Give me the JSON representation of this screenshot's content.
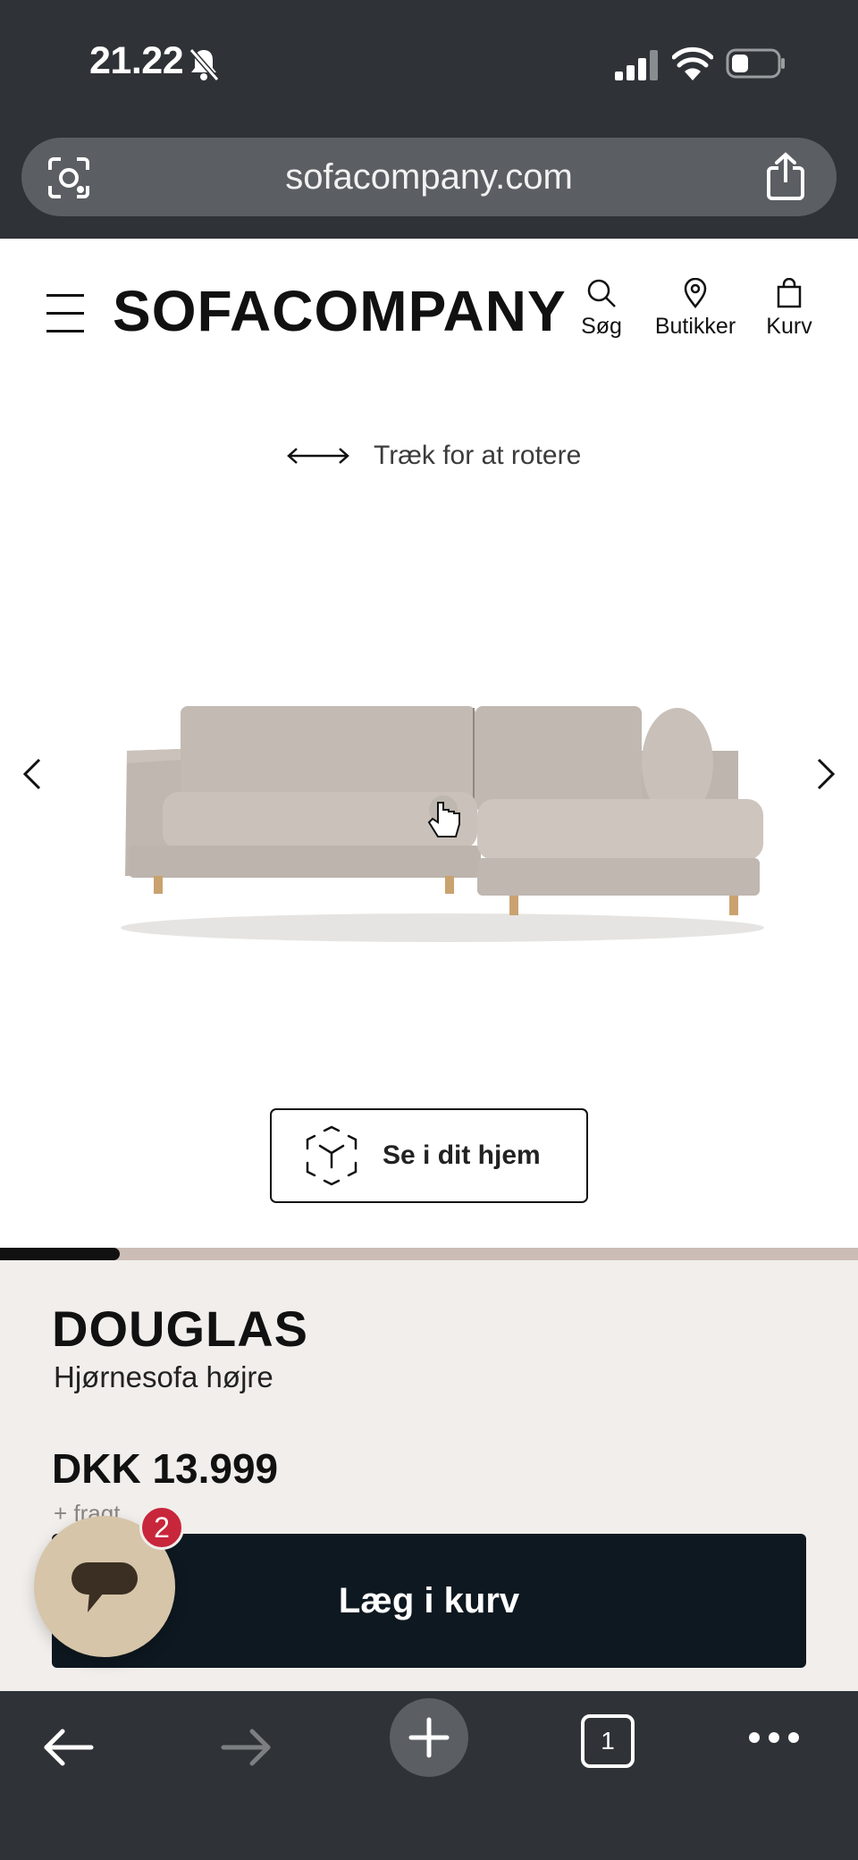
{
  "status_bar": {
    "time": "21.22",
    "icons": [
      "bell-slash-icon",
      "cellular-signal-icon",
      "wifi-icon",
      "battery-icon"
    ]
  },
  "browser": {
    "url": "sofacompany.com",
    "icons": [
      "visual-search-icon",
      "share-icon"
    ],
    "bottom_bar": {
      "tab_count": "1",
      "icons": [
        "back-arrow-icon",
        "forward-arrow-icon",
        "new-tab-plus-icon",
        "tabs-icon",
        "more-icon"
      ]
    }
  },
  "header": {
    "logo": "SOFACOMPANY",
    "nav": [
      {
        "label": "Søg",
        "icon": "search-icon"
      },
      {
        "label": "Butikker",
        "icon": "location-pin-icon"
      },
      {
        "label": "Kurv",
        "icon": "shopping-bag-icon"
      }
    ]
  },
  "viewer": {
    "rotate_hint": "Træk for at rotere",
    "ar_button_label": "Se i dit hjem",
    "image_progress": 0.14
  },
  "product": {
    "name": "DOUGLAS",
    "subtitle": "Hjørnesofa højre",
    "price": "DKK 13.999",
    "freight_note": "+ fragt",
    "add_to_cart_label": "Læg i kurv"
  },
  "chat": {
    "unread_count": "2"
  },
  "colors": {
    "chrome": "#2f3236",
    "info_background": "#f1eeeb",
    "cart_button": "#0e1820",
    "chat_bubble": "#d6c5a9",
    "badge": "#c8263b"
  }
}
